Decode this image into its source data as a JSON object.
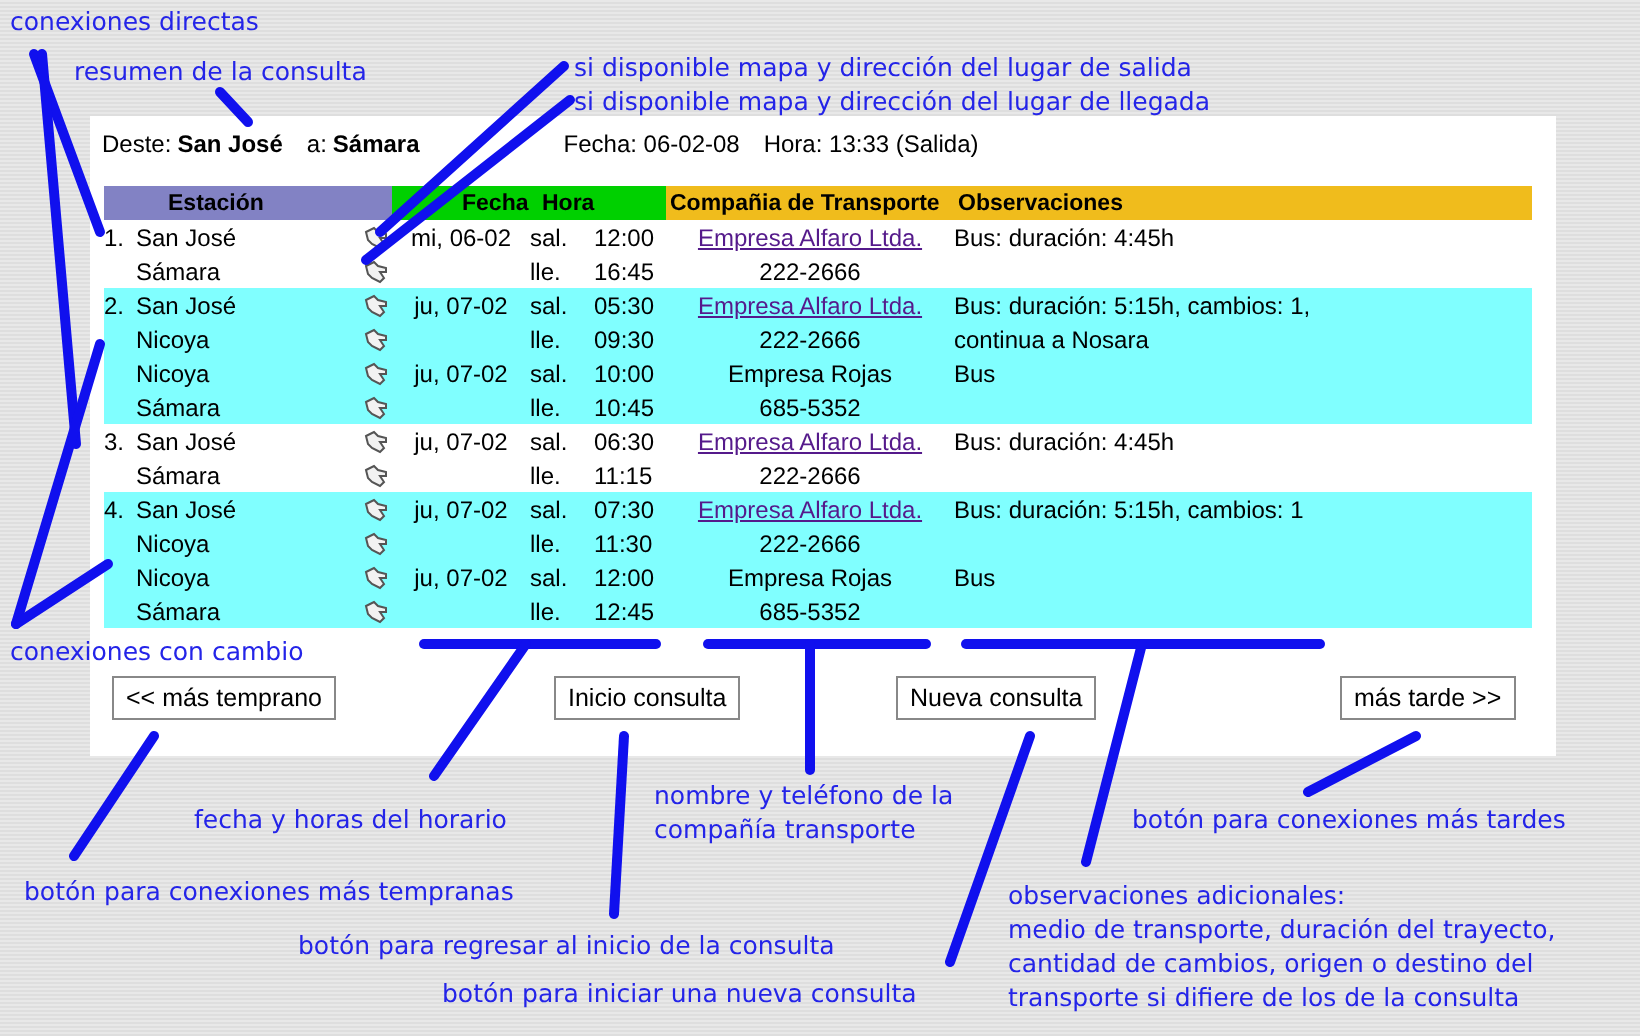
{
  "summary": {
    "from_label": "Deste:",
    "from": "San José",
    "to_label": "a:",
    "to": "Sámara",
    "date": "Fecha: 06-02-08",
    "time": "Hora: 13:33 (Salida)"
  },
  "table": {
    "columns": [
      "Estación",
      "Fecha",
      "Hora",
      "Compañia de Transporte",
      "Observaciones"
    ],
    "connections": [
      {
        "number": "1.",
        "kind": "direct",
        "rows": [
          {
            "station": "San José",
            "map": true,
            "date": "mi, 06-02",
            "dir": "sal.",
            "time": "12:00",
            "company": "Empresa Alfaro Ltda.",
            "link": true,
            "note": "Bus: duración: 4:45h"
          },
          {
            "station": "Sámara",
            "map": true,
            "date": "",
            "dir": "lle.",
            "time": "16:45",
            "company": "222-2666",
            "link": false,
            "note": ""
          }
        ]
      },
      {
        "number": "2.",
        "kind": "transfer",
        "rows": [
          {
            "station": "San José",
            "map": true,
            "date": "ju, 07-02",
            "dir": "sal.",
            "time": "05:30",
            "company": "Empresa Alfaro Ltda.",
            "link": true,
            "note": "Bus: duración: 5:15h, cambios: 1,"
          },
          {
            "station": "Nicoya",
            "map": true,
            "date": "",
            "dir": "lle.",
            "time": "09:30",
            "company": "222-2666",
            "link": false,
            "note": "continua a Nosara"
          },
          {
            "station": "Nicoya",
            "map": true,
            "date": "ju, 07-02",
            "dir": "sal.",
            "time": "10:00",
            "company": "Empresa Rojas",
            "link": false,
            "note": "Bus"
          },
          {
            "station": "Sámara",
            "map": true,
            "date": "",
            "dir": "lle.",
            "time": "10:45",
            "company": "685-5352",
            "link": false,
            "note": ""
          }
        ]
      },
      {
        "number": "3.",
        "kind": "direct",
        "rows": [
          {
            "station": "San José",
            "map": true,
            "date": "ju, 07-02",
            "dir": "sal.",
            "time": "06:30",
            "company": "Empresa Alfaro Ltda.",
            "link": true,
            "note": "Bus: duración: 4:45h"
          },
          {
            "station": "Sámara",
            "map": true,
            "date": "",
            "dir": "lle.",
            "time": "11:15",
            "company": "222-2666",
            "link": false,
            "note": ""
          }
        ]
      },
      {
        "number": "4.",
        "kind": "transfer",
        "rows": [
          {
            "station": "San José",
            "map": true,
            "date": "ju, 07-02",
            "dir": "sal.",
            "time": "07:30",
            "company": "Empresa Alfaro Ltda.",
            "link": true,
            "note": "Bus: duración: 5:15h, cambios: 1"
          },
          {
            "station": "Nicoya",
            "map": true,
            "date": "",
            "dir": "lle.",
            "time": "11:30",
            "company": "222-2666",
            "link": false,
            "note": ""
          },
          {
            "station": "Nicoya",
            "map": true,
            "date": "ju, 07-02",
            "dir": "sal.",
            "time": "12:00",
            "company": "Empresa Rojas",
            "link": false,
            "note": "Bus"
          },
          {
            "station": "Sámara",
            "map": true,
            "date": "",
            "dir": "lle.",
            "time": "12:45",
            "company": "685-5352",
            "link": false,
            "note": ""
          }
        ]
      }
    ]
  },
  "buttons": [
    "<< más temprano",
    "Inicio consulta",
    "Nueva consulta",
    "más tarde >>"
  ],
  "annotations": [
    {
      "text": "conexiones directas"
    },
    {
      "text": "resumen de la consulta"
    },
    {
      "text": "si disponible mapa y dirección del lugar de salida"
    },
    {
      "text": "si disponible mapa y dirección del lugar de llegada"
    },
    {
      "text": "conexiones con cambio"
    },
    {
      "text": "fecha y horas del horario"
    },
    {
      "text": "nombre y teléfono de la\ncompañía transporte"
    },
    {
      "text": "botón para conexiones más tardes"
    },
    {
      "text": "botón para conexiones más tempranas"
    },
    {
      "text": "botón para regresar al inicio de la consulta"
    },
    {
      "text": "botón para iniciar una nueva consulta"
    },
    {
      "text": "observaciones adicionales:\nmedio de transporte, duración del trayecto,\ncantidad de cambios, origen o destino del\ntransporte si difiere de los de la consulta"
    }
  ]
}
